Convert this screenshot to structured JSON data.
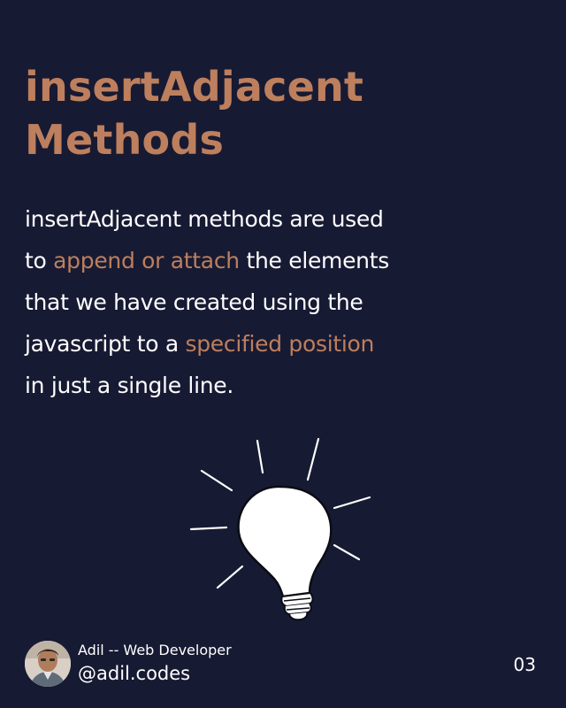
{
  "title": {
    "line1": "insertAdjacent",
    "line2": "Methods"
  },
  "body": {
    "line1": "insertAdjacent methods are used",
    "line2_pre": "to ",
    "line2_hl": "append or attach",
    "line2_post": " the elements",
    "line3": "that we have created using the",
    "line4_pre": "javascript to a ",
    "line4_hl": "specified position",
    "line5": "in just a single line."
  },
  "footer": {
    "role": "Adil -- Web Developer",
    "handle": "@adil.codes",
    "page_number": "03"
  },
  "icons": {
    "illustration": "lightbulb-icon",
    "avatar": "avatar"
  },
  "colors": {
    "background": "#171a33",
    "accent": "#bd7f5d",
    "text": "#ffffff"
  }
}
